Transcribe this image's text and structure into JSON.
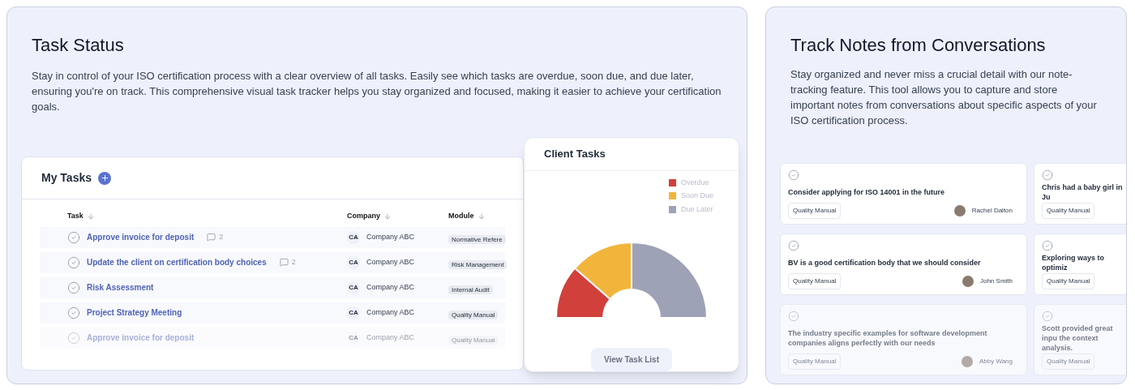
{
  "task_status": {
    "title": "Task Status",
    "description": "Stay in control of your ISO certification process with a clear overview of all tasks. Easily see which tasks are overdue, soon due, and due later, ensuring you're on track. This comprehensive visual task tracker helps you stay organized and focused, making it easier to achieve your certification goals.",
    "my_tasks": {
      "title": "My Tasks",
      "columns": [
        "Task",
        "Company",
        "Module"
      ],
      "rows": [
        {
          "task": "Approve invoice for deposit",
          "comments": "2",
          "initials": "CA",
          "company": "Company ABC",
          "module": "Normative Refere"
        },
        {
          "task": "Update the client on certification body choices",
          "comments": "2",
          "initials": "CA",
          "company": "Company ABC",
          "module": "Risk Management"
        },
        {
          "task": "Risk Assessment",
          "initials": "CA",
          "company": "Company ABC",
          "module": "Internal Audit"
        },
        {
          "task": "Project Strategy Meeting",
          "initials": "CA",
          "company": "Company ABC",
          "module": "Quality Manual"
        },
        {
          "task": "Approve invoice for deposit",
          "initials": "CA",
          "company": "Company ABC",
          "module": "Quality Manual"
        }
      ]
    },
    "client_tasks": {
      "title": "Client Tasks",
      "legend": [
        {
          "label": "Overdue",
          "color": "#d2403b"
        },
        {
          "label": "Soon Due",
          "color": "#f2b53c"
        },
        {
          "label": "Due Later",
          "color": "#9ea2b6"
        }
      ],
      "button": "View Task List"
    }
  },
  "track_notes": {
    "title": "Track Notes from Conversations",
    "description": "Stay organized and never miss a crucial detail with our note-tracking feature. This tool allows you to capture and store important notes from conversations about specific aspects of your ISO certification process.",
    "notes": [
      {
        "text": "Consider applying for ISO 14001 in the future",
        "tag": "Quality Manual",
        "author": "Rachel Dalton"
      },
      {
        "text": "Chris had a baby girl in Ju",
        "tag": "Quality Manual"
      },
      {
        "text": "BV is a good certification body that we should consider",
        "tag": "Quality Manual",
        "author": "John Smith"
      },
      {
        "text": "Exploring ways to optimiz",
        "tag": "Quality Manual"
      },
      {
        "text": "The industry specific examples for software development companies aligns perfectly with our needs",
        "tag": "Quality Manual",
        "author": "Abby Wang"
      },
      {
        "text": "Scott provided great inpu the context analysis.",
        "tag": "Quality Manual"
      }
    ]
  }
}
